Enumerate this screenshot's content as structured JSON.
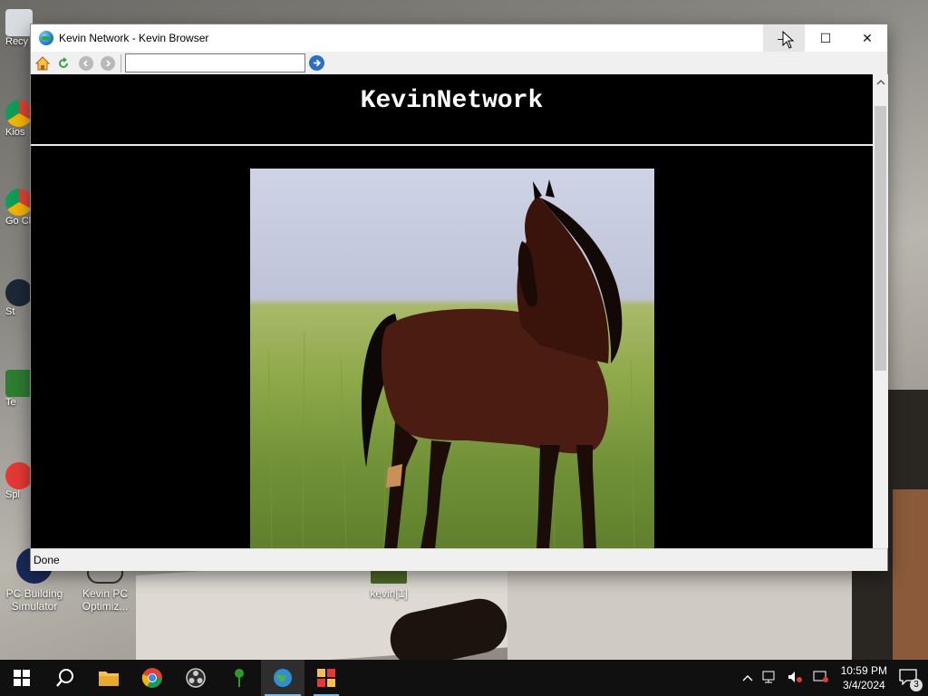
{
  "desktop": {
    "icons": [
      {
        "label": "PC Building Simulator"
      },
      {
        "label": "Kevin PC Optimiz..."
      },
      {
        "label": "kevin[1]"
      }
    ],
    "partial_icons": [
      {
        "label": "Recy"
      },
      {
        "label": "Kios"
      },
      {
        "label": "Go Ch"
      },
      {
        "label": "St"
      },
      {
        "label": "Te"
      },
      {
        "label": "Spl"
      }
    ]
  },
  "window": {
    "title": "Kevin Network - Kevin Browser",
    "controls": {
      "minimize": "—",
      "maximize": "☐",
      "close": "✕"
    },
    "toolbar": {
      "address_value": ""
    },
    "page": {
      "heading": "KevinNetwork",
      "image_subject": "horse"
    },
    "status": "Done"
  },
  "taskbar": {
    "clock_time": "10:59 PM",
    "clock_date": "3/4/2024",
    "notification_count": "3"
  },
  "colors": {
    "page_bg": "#000000",
    "taskbar_bg": "#101010",
    "accent": "#76b9ed"
  }
}
